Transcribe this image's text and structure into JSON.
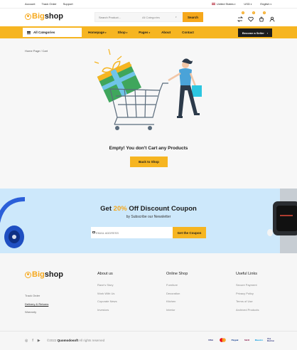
{
  "topbar": {
    "links": [
      "Account",
      "Track Order",
      "Support"
    ],
    "country": "United States",
    "currency": "USD",
    "language": "English"
  },
  "header": {
    "logo_big": "Big",
    "logo_shop": "shop",
    "search_placeholder": "Search Product...",
    "search_category": "All Categories",
    "search_button": "Search",
    "compare_count": "0",
    "wishlist_count": "0",
    "cart_count": "0"
  },
  "nav": {
    "all_categories": "All Categories",
    "links": [
      "Homepage",
      "Shop",
      "Pages",
      "About",
      "Contact"
    ],
    "seller_button": "Become a Seller"
  },
  "main": {
    "breadcrumb": "Home Page / Cart",
    "empty_title": "Empty! You don't Cart any Products",
    "back_button": "Back to Shop"
  },
  "coupon": {
    "title_prefix": "Get",
    "title_percent": "20%",
    "title_suffix": "Off Discount Coupon",
    "subtitle": "by Subscribe our Newsletter",
    "email_placeholder": "EMAIL ADDRESS",
    "button": "Get the Coupon"
  },
  "footer": {
    "left_links": [
      "Track Order",
      "Delivery & Returns",
      "Warranty"
    ],
    "columns": [
      {
        "title": "About us",
        "items": [
          "Rave's Story",
          "Work With Us",
          "Coporate News",
          "Investors"
        ]
      },
      {
        "title": "Online Shop",
        "items": [
          "Furniture",
          "Decoration",
          "Kitchen",
          "Interior"
        ]
      },
      {
        "title": "Useful Links",
        "items": [
          "Secure Payment",
          "Privacy Policy",
          "Terms of Use",
          "Archived Products"
        ]
      }
    ],
    "copyright_prefix": "©2022",
    "copyright_brand": "Quomodosoft",
    "copyright_suffix": "All rights reserved",
    "payments": [
      "VISA",
      "MC",
      "Paypal",
      "Skrill",
      "Maestro",
      "Visa Electron"
    ]
  },
  "colors": {
    "accent": "#f6b521",
    "dark": "#1d1d1d",
    "coupon_bg": "#cde8fb"
  }
}
